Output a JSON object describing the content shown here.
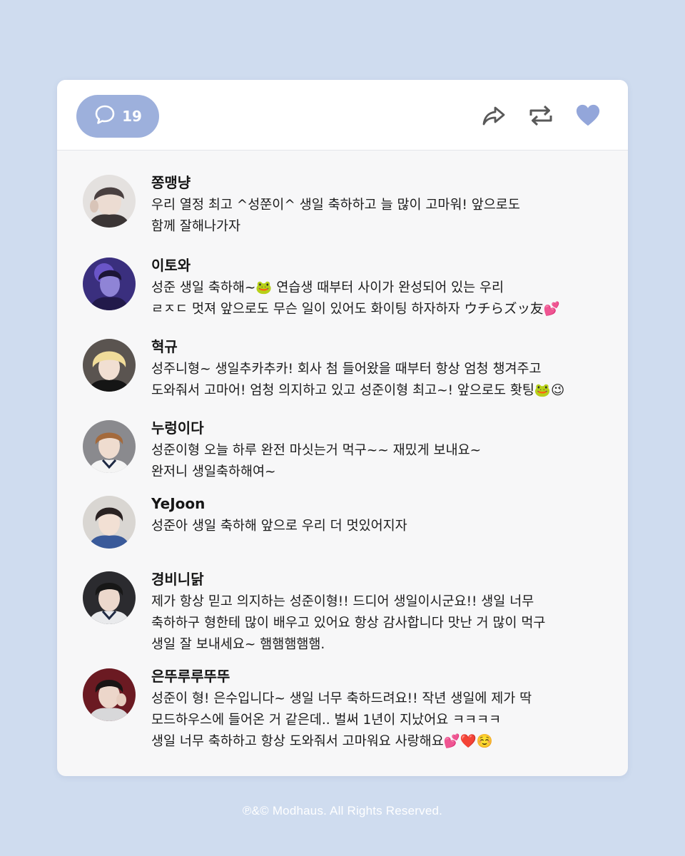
{
  "post": {
    "comment_count": "19",
    "icons": {
      "comment": "speech-bubble-icon",
      "share": "share-arrow-icon",
      "repost": "repeat-icon",
      "like": "heart-icon"
    },
    "colors": {
      "background": "#cfdcef",
      "accent": "#9db0dc",
      "heart": "#93a6da"
    }
  },
  "comments": [
    {
      "name": "쫑맹냥",
      "text": "우리 열정 최고 ^성쭌이^ 생일 축하하고 늘 많이 고마워! 앞으로도\n함께 잘해나가자"
    },
    {
      "name": "이토와",
      "text": "성준 생일 축하해~🐸 연습생 때부터 사이가 완성되어 있는 우리\nㄹㅈㄷ 멋져 앞으로도 무슨 일이 있어도 화이팅 하자하자 ウチらズッ友💕"
    },
    {
      "name": "혁규",
      "text": "성주니형~ 생일추카추카! 회사 첨 들어왔을 때부터 항상 엄청 챙겨주고\n도와줘서 고마어! 엄청 의지하고 있고 성준이형 최고~! 앞으로도 홧팅🐸😉"
    },
    {
      "name": "누렁이다",
      "text": "성준이형 오늘 하루 완전 마싯는거 먹구~~ 재밌게 보내요~\n완저니 생일축하해여~"
    },
    {
      "name": "YeJoon",
      "text": "성준아 생일 축하해 앞으로 우리 더 멋있어지자"
    },
    {
      "name": "경비니닭",
      "text": "제가 항상 믿고 의지하는 성준이형!! 드디어 생일이시군요!! 생일 너무\n축하하구 형한테 많이 배우고 있어요 항상 감사합니다 맛난 거 많이 먹구\n생일 잘 보내세요~ 햄햄햄햄햄."
    },
    {
      "name": "은뚜루루뚜뚜",
      "text": "성준이 형! 은수입니다~ 생일 너무 축하드려요!! 작년 생일에 제가 딱\n모드하우스에 들어온 거 같은데.. 벌써 1년이 지났어요 ㅋㅋㅋㅋ\n생일 너무 축하하고 항상 도와줘서 고마워요 사랑해요💕❤️☺️"
    }
  ],
  "footer": {
    "copyright": "℗&© Modhaus. All Rights Reserved."
  }
}
